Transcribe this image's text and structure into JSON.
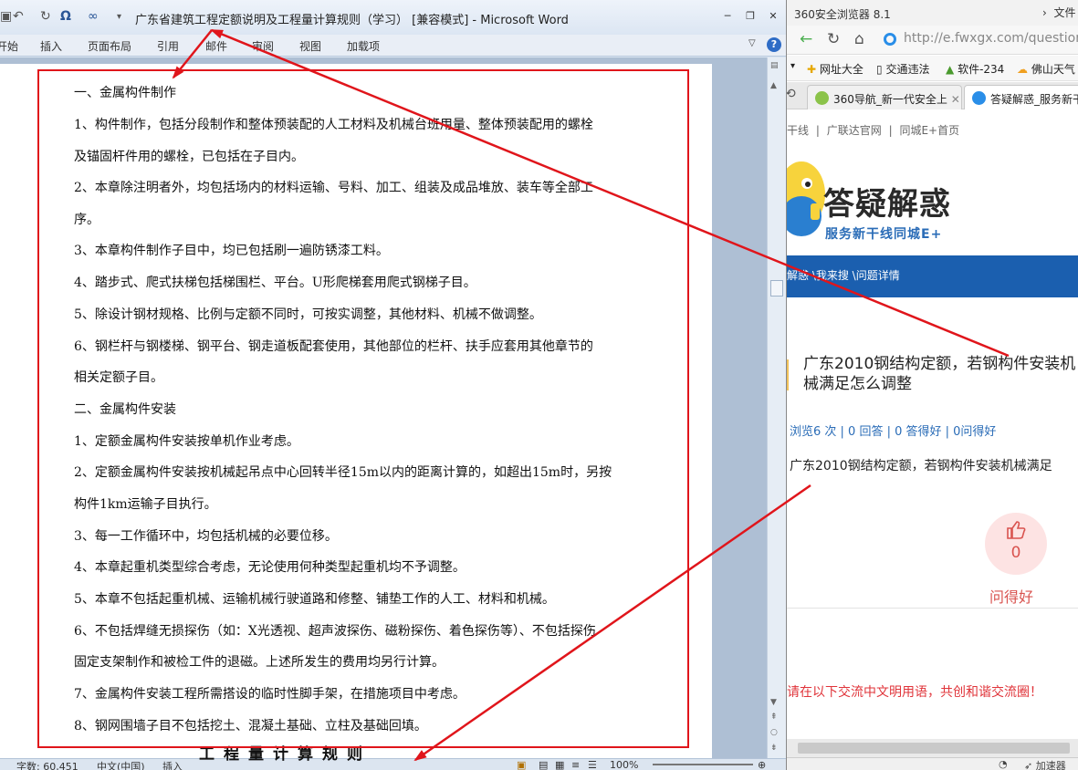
{
  "word": {
    "window_title": "广东省建筑工程定额说明及工程量计算规则（学习） [兼容模式] - Microsoft Word",
    "quick_access": {
      "undo": "↶",
      "redo": "↻",
      "omega": "Ω",
      "infinity": "∞"
    },
    "ribbon_tabs": [
      "开始",
      "插入",
      "页面布局",
      "引用",
      "邮件",
      "审阅",
      "视图",
      "加载项"
    ],
    "help_glyph": "?",
    "document_lines": [
      "一、金属构件制作",
      "1、构件制作，包括分段制作和整体预装配的人工材料及机械台班用量、整体预装配用的螺栓",
      "及锚固杆件用的螺栓，已包括在子目内。",
      "2、本章除注明者外，均包括场内的材料运输、号料、加工、组装及成品堆放、装车等全部工",
      "序。",
      "3、本章构件制作子目中，均已包括刷一遍防锈漆工料。",
      "4、踏步式、爬式扶梯包括梯围栏、平台。U形爬梯套用爬式钢梯子目。",
      "5、除设计钢材规格、比例与定额不同时，可按实调整，其他材料、机械不做调整。",
      "6、钢栏杆与钢楼梯、钢平台、钢走道板配套使用，其他部位的栏杆、扶手应套用其他章节的",
      "相关定额子目。",
      "二、金属构件安装",
      "1、定额金属构件安装按单机作业考虑。",
      "2、定额金属构件安装按机械起吊点中心回转半径15m以内的距离计算的，如超出15m时，另按",
      "构件1km运输子目执行。",
      "3、每一工作循环中，均包括机械的必要位移。",
      "4、本章起重机类型综合考虑，无论使用何种类型起重机均不予调整。",
      "5、本章不包括起重机械、运输机械行驶道路和修整、铺垫工作的人工、材料和机械。",
      "6、不包括焊缝无损探伤（如：X光透视、超声波探伤、磁粉探伤、着色探伤等）、不包括探伤",
      "固定支架制作和被检工件的退磁。上述所发生的费用均另行计算。",
      "7、金属构件安装工程所需搭设的临时性脚手架，在措施项目中考虑。",
      "8、钢网围墙子目不包括挖土、混凝土基础、立柱及基础回填。"
    ],
    "behind_heading": "工程量计算规则",
    "status": {
      "word_count": "字数: 60,451",
      "language": "中文(中国)",
      "mode": "插入",
      "zoom": "100%"
    },
    "accent_color": "#e0151b"
  },
  "browser": {
    "window_title": "360安全浏览器 8.1",
    "menu": "文件",
    "url": "http://e.fwxgx.com/question_",
    "favorites": [
      "网址大全",
      "交通违法",
      "软件-234",
      "佛山天气"
    ],
    "tabs": [
      "360导航_新一代安全上",
      "答疑解惑_服务新干"
    ],
    "site_links": [
      "干线",
      "|",
      "广联达官网",
      "|",
      "同城E+首页"
    ],
    "logo_title": "答疑解惑",
    "logo_subtitle": "服务新干线同城E+",
    "breadcrumb": "解惑 \\我来搜 \\问题详情",
    "question_title": "广东2010钢结构定额，若钢构件安装机械满足怎么调整",
    "question_stats": "浏览6 次 | 0 回答 | 0 答得好 | 0问得好",
    "question_body": "广东2010钢结构定额，若钢构件安装机械满足",
    "like_count": "0",
    "like_label": "问得好",
    "notice": "请在以下交流中文明用语，共创和谐交流圈！",
    "status_right": "加速器",
    "brand_color": "#1b5faf"
  }
}
